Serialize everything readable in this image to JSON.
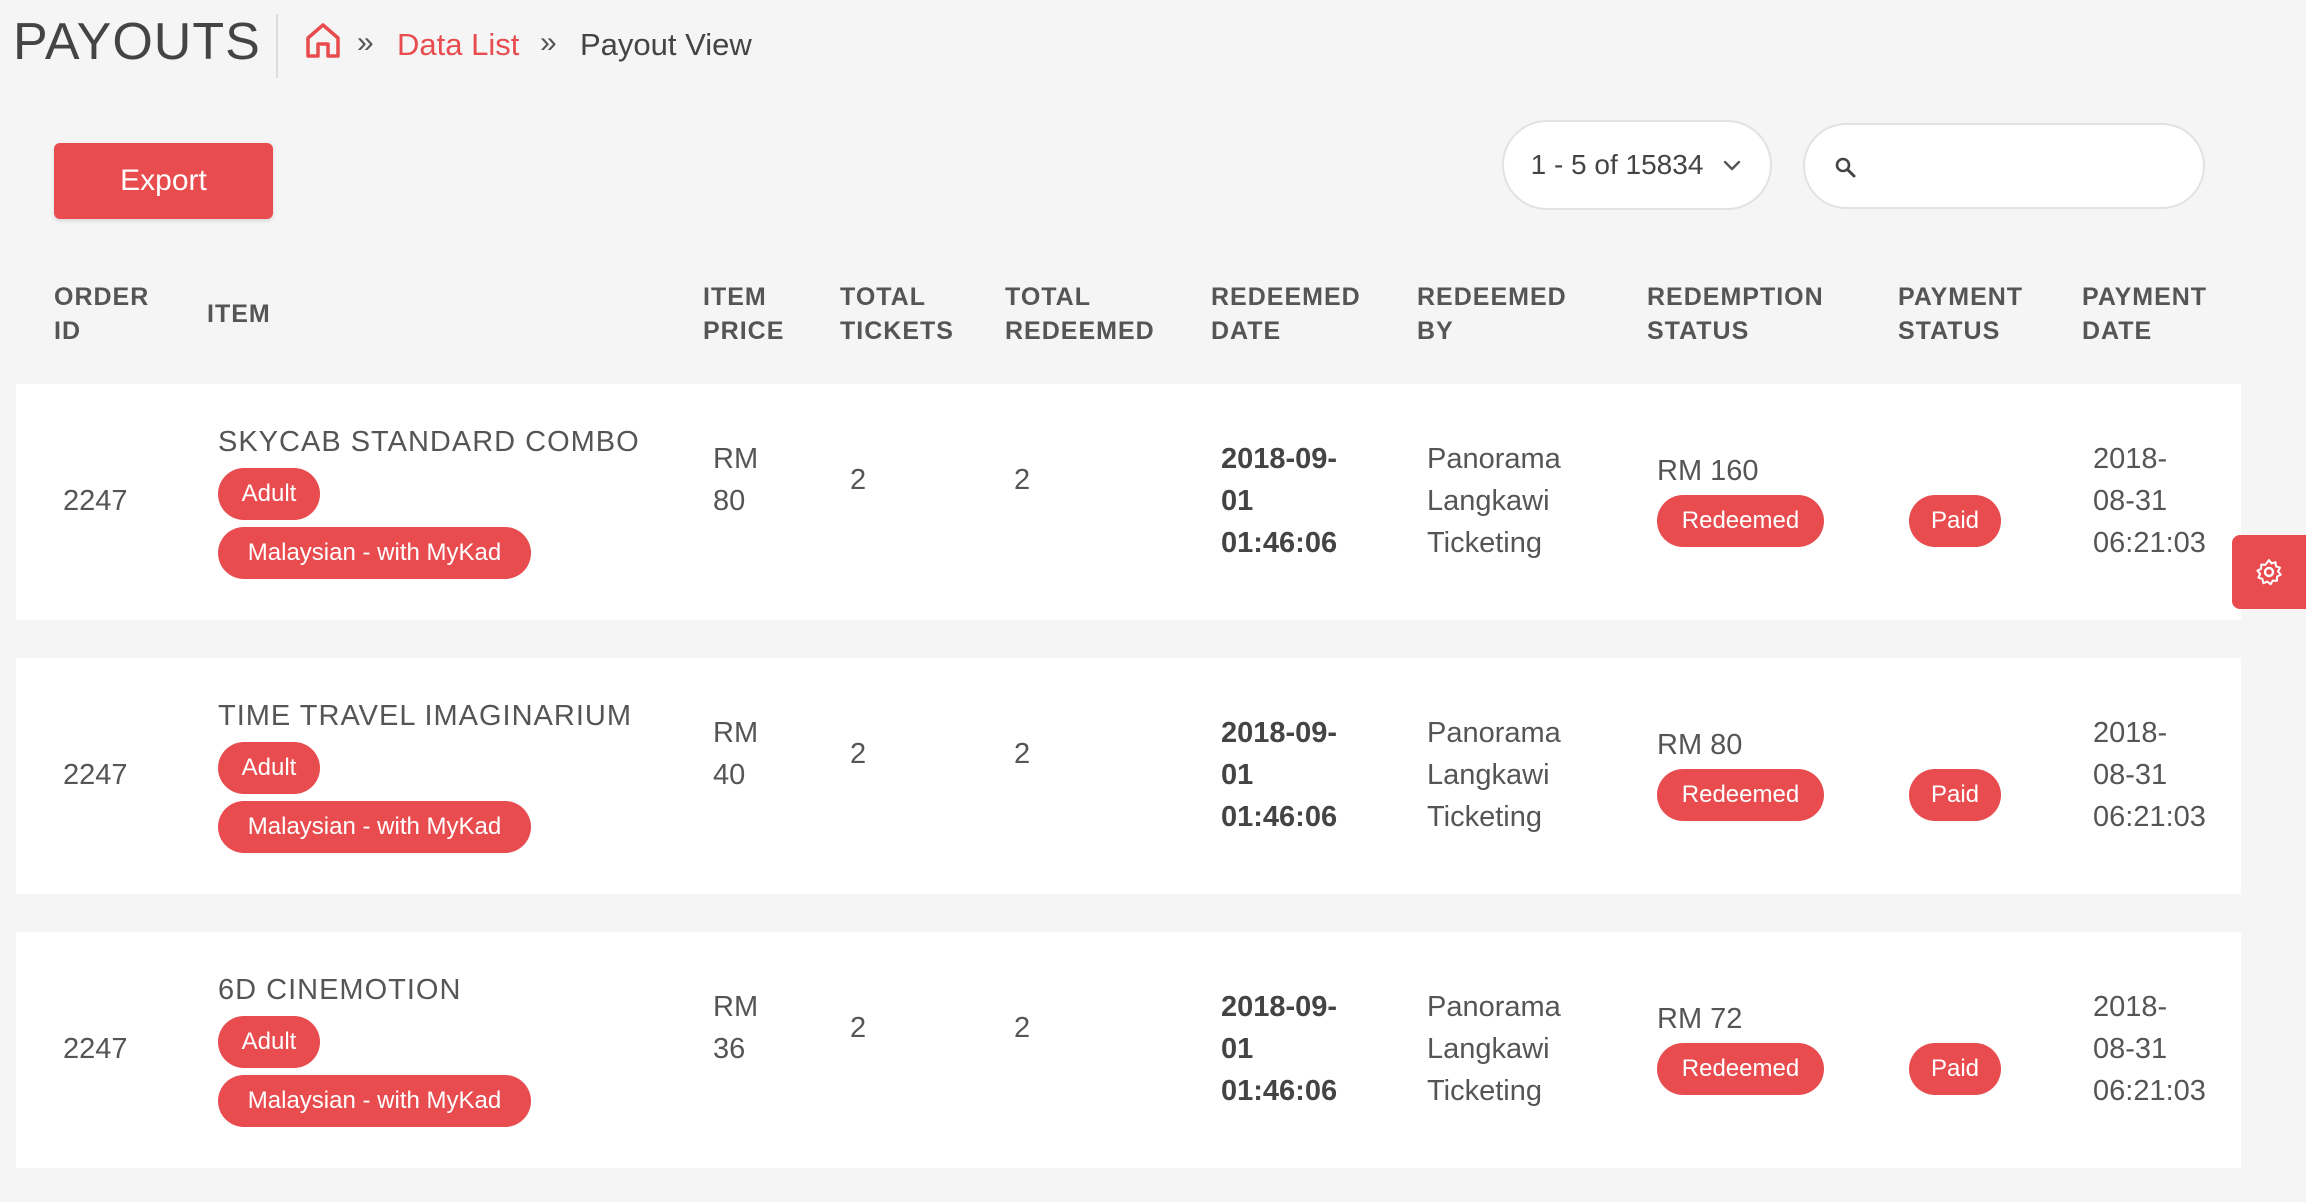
{
  "header": {
    "title": "PAYOUTS",
    "breadcrumb": {
      "home_icon": "home-icon",
      "separator": "»",
      "link": "Data List",
      "current": "Payout View"
    }
  },
  "toolbar": {
    "export_label": "Export",
    "pagination_label": "1 - 5 of 15834",
    "search_placeholder": "",
    "search_value": ""
  },
  "table": {
    "columns": [
      [
        "ORDER",
        "ID"
      ],
      [
        "ITEM",
        ""
      ],
      [
        "ITEM",
        "PRICE"
      ],
      [
        "TOTAL",
        "TICKETS"
      ],
      [
        "TOTAL",
        "REDEEMED"
      ],
      [
        "REDEEMED",
        "DATE"
      ],
      [
        "REDEEMED",
        "BY"
      ],
      [
        "REDEMPTION",
        "STATUS"
      ],
      [
        "PAYMENT",
        "STATUS"
      ],
      [
        "PAYMENT",
        "DATE"
      ]
    ],
    "rows": [
      {
        "order_id": "2247",
        "item": "SKYCAB STANDARD COMBO",
        "tags": [
          "Adult",
          "Malaysian - with MyKad"
        ],
        "price": [
          "RM",
          "80"
        ],
        "total_tickets": "2",
        "total_redeemed": "2",
        "redeemed_date": [
          "2018-09-",
          "01",
          "01:46:06"
        ],
        "redeemed_by": [
          "Panorama",
          "Langkawi",
          "Ticketing"
        ],
        "redemption_amount": "RM 160",
        "redemption_status": "Redeemed",
        "payment_status": "Paid",
        "payment_date": [
          "2018-",
          "08-31",
          "06:21:03"
        ]
      },
      {
        "order_id": "2247",
        "item": "TIME TRAVEL IMAGINARIUM",
        "tags": [
          "Adult",
          "Malaysian - with MyKad"
        ],
        "price": [
          "RM",
          "40"
        ],
        "total_tickets": "2",
        "total_redeemed": "2",
        "redeemed_date": [
          "2018-09-",
          "01",
          "01:46:06"
        ],
        "redeemed_by": [
          "Panorama",
          "Langkawi",
          "Ticketing"
        ],
        "redemption_amount": "RM 80",
        "redemption_status": "Redeemed",
        "payment_status": "Paid",
        "payment_date": [
          "2018-",
          "08-31",
          "06:21:03"
        ]
      },
      {
        "order_id": "2247",
        "item": "6D CINEMOTION",
        "tags": [
          "Adult",
          "Malaysian - with MyKad"
        ],
        "price": [
          "RM",
          "36"
        ],
        "total_tickets": "2",
        "total_redeemed": "2",
        "redeemed_date": [
          "2018-09-",
          "01",
          "01:46:06"
        ],
        "redeemed_by": [
          "Panorama",
          "Langkawi",
          "Ticketing"
        ],
        "redemption_amount": "RM 72",
        "redemption_status": "Redeemed",
        "payment_status": "Paid",
        "payment_date": [
          "2018-",
          "08-31",
          "06:21:03"
        ]
      }
    ]
  },
  "settings_fab": {
    "icon": "gear-icon"
  },
  "colors": {
    "accent": "#e84c4f",
    "background": "#f5f5f5",
    "row": "#ffffff"
  }
}
